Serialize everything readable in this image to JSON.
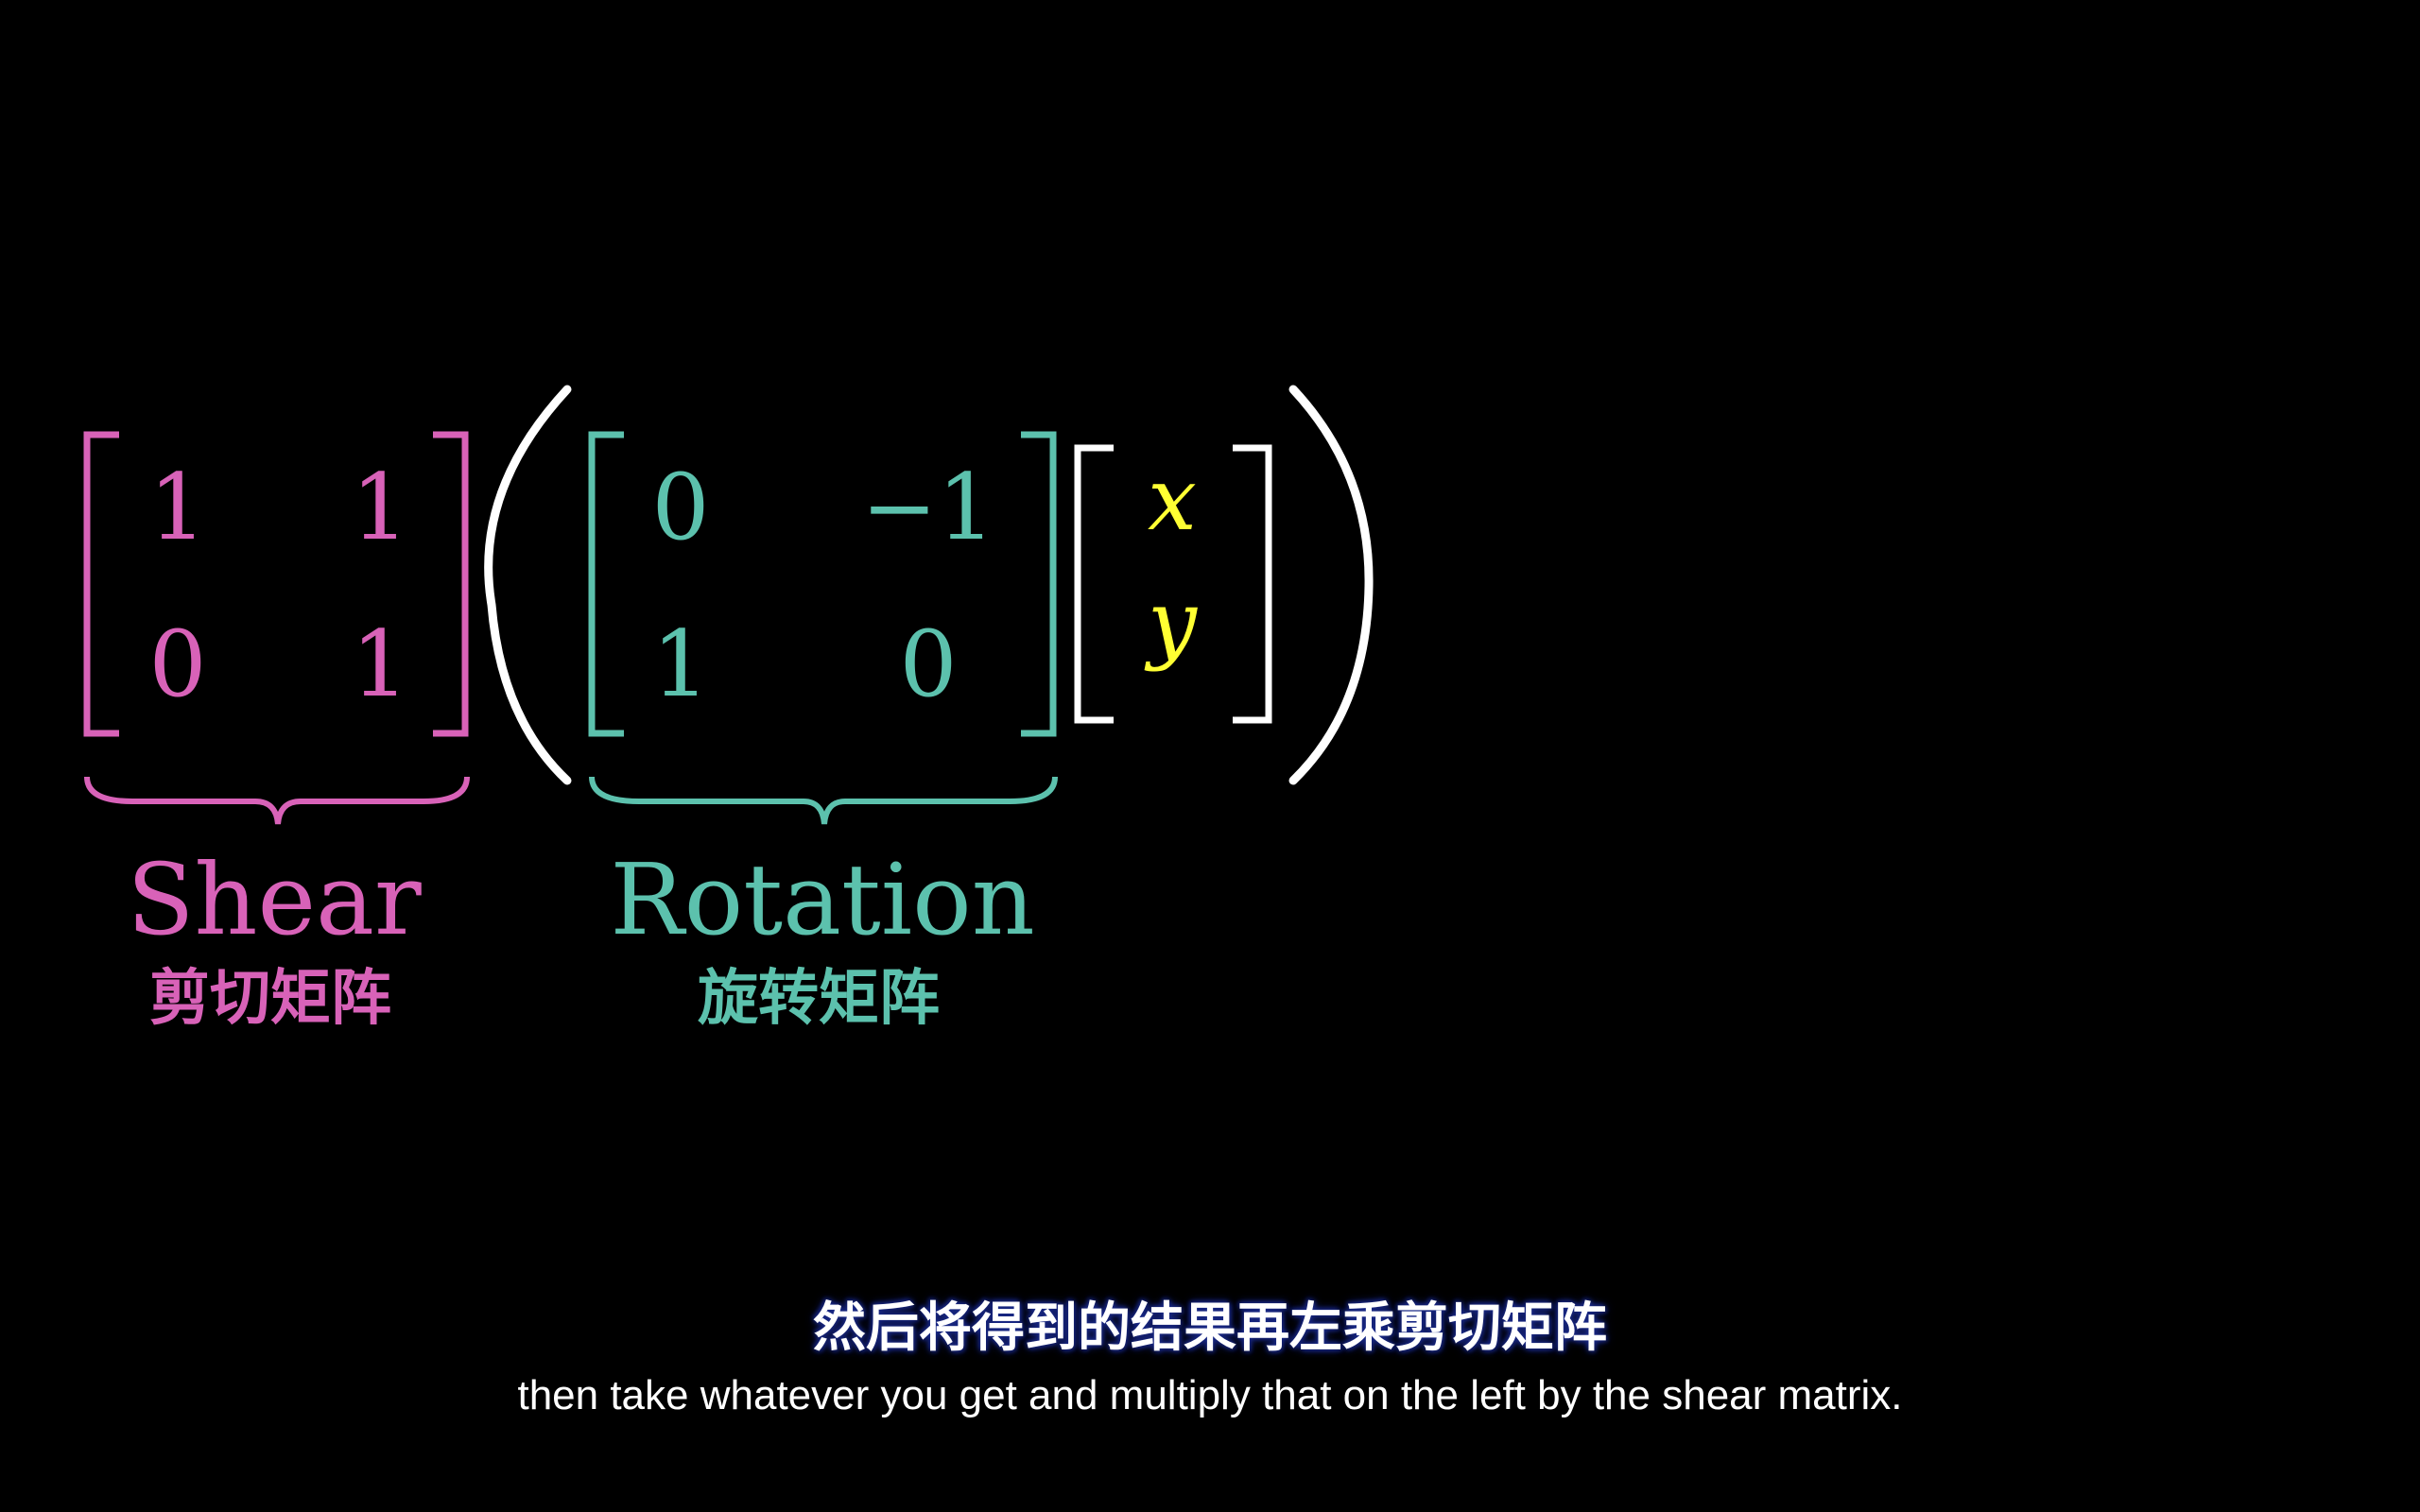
{
  "colors": {
    "background": "#000000",
    "shear": "#d862b8",
    "rotation": "#5cc1ad",
    "vector": "#ffff33",
    "parens": "#ffffff"
  },
  "shear_matrix": {
    "r1c1": "1",
    "r1c2": "1",
    "r2c1": "0",
    "r2c2": "1",
    "label": "Shear",
    "label_zh": "剪切矩阵"
  },
  "rotation_matrix": {
    "r1c1": "0",
    "r1c2": "−1",
    "r2c1": "1",
    "r2c2": "0",
    "label": "Rotation",
    "label_zh": "旋转矩阵"
  },
  "vector": {
    "x": "x",
    "y": "y"
  },
  "subtitles": {
    "zh": "然后将得到的结果再左乘剪切矩阵",
    "en": "then take whatever you get and multiply that on the left by the shear matrix."
  }
}
